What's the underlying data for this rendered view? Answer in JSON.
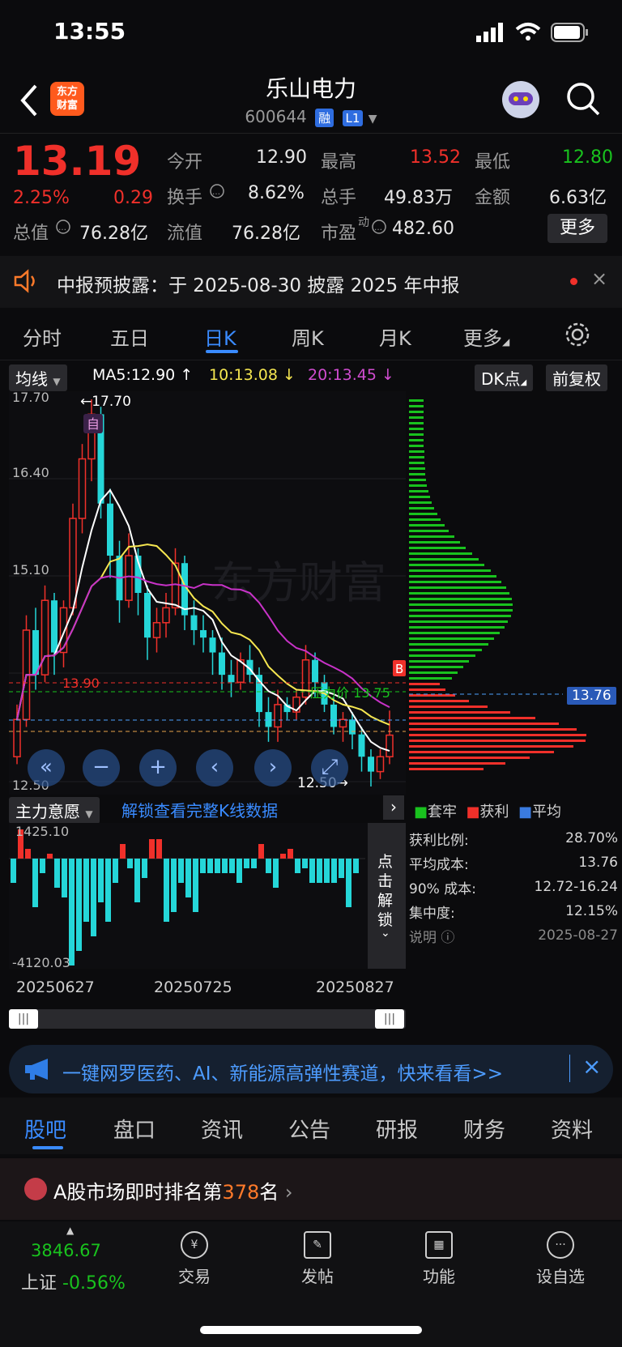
{
  "status": {
    "time": "13:55"
  },
  "header": {
    "title": "乐山电力",
    "code": "600644",
    "tag1": "融",
    "tag2": "L1",
    "logo_line1": "东方",
    "logo_line2": "财富"
  },
  "quote": {
    "price": "13.19",
    "pct": "2.25%",
    "chg": "0.29",
    "open_label": "今开",
    "open": "12.90",
    "high_label": "最高",
    "high": "13.52",
    "low_label": "最低",
    "low": "12.80",
    "turnover_label": "换手",
    "turnover": "8.62%",
    "volume_label": "总手",
    "volume": "49.83万",
    "amount_label": "金额",
    "amount": "6.63亿",
    "mktcap_label": "总值",
    "mktcap": "76.28亿",
    "float_label": "流值",
    "float": "76.28亿",
    "pe_label": "市盈",
    "pe_sup": "动",
    "pe": "482.60",
    "more": "更多"
  },
  "notice": {
    "text": "中报预披露：于 2025-08-30 披露 2025 年中报"
  },
  "chart_tabs": [
    "分时",
    "五日",
    "日K",
    "周K",
    "月K",
    "更多",
    ""
  ],
  "chart_tabs_active": 2,
  "ma_bar": {
    "select": "均线",
    "ma5": "MA5:12.90 ↑",
    "ma10": "10:13.08 ↓",
    "ma20": "20:13.45 ↓",
    "dk": "DK点",
    "adj": "前复权"
  },
  "price_axis": {
    "p1": "17.70",
    "p2": "16.40",
    "p3": "15.10",
    "p5": "12.50"
  },
  "annotations": {
    "high": "←17.70",
    "low": "12.50→",
    "red_line": "13.90",
    "green_line": "压力价 13.75",
    "avg_cost": "13.76",
    "marker_self": "自",
    "marker_b": "B"
  },
  "sub": {
    "select": "主力意愿",
    "unlock": "解锁查看完整K线数据",
    "top": "1425.10",
    "bottom": "-4120.03",
    "side": "点击解锁"
  },
  "dates": [
    "20250627",
    "20250725",
    "20250827"
  ],
  "chip": {
    "legend": [
      "套牢",
      "获利",
      "平均"
    ],
    "rows": [
      {
        "k": "获利比例:",
        "v": "28.70%"
      },
      {
        "k": "平均成本:",
        "v": "13.76"
      },
      {
        "k": "90% 成本:",
        "v": "12.72-16.24"
      },
      {
        "k": "集中度:",
        "v": "12.15%"
      }
    ],
    "note": "说明",
    "date": "2025-08-27"
  },
  "ad": {
    "text": "一键网罗医药、AI、新能源高弹性赛道，快来看看>>"
  },
  "bottom_tabs": [
    "股吧",
    "盘口",
    "资讯",
    "公告",
    "研报",
    "财务",
    "资料"
  ],
  "rank": {
    "prefix": "A股市场即时排名第",
    "num": "378",
    "suffix": "名"
  },
  "index": {
    "value": "3846.67",
    "name": "上证",
    "pct": "-0.56%"
  },
  "nav": [
    "交易",
    "发帖",
    "功能",
    "设自选"
  ],
  "colors": {
    "up": "#f0302a",
    "down": "#19c21e",
    "cyan": "#25d6d8",
    "ma5": "#ffffff",
    "ma10": "#f5e650",
    "ma20": "#c832c8"
  },
  "chart_data": {
    "type": "candlestick",
    "ylim": [
      12.5,
      17.7
    ],
    "candles": [
      {
        "o": 12.9,
        "c": 13.4,
        "h": 13.6,
        "l": 12.8
      },
      {
        "o": 13.4,
        "c": 14.6,
        "h": 14.8,
        "l": 13.3
      },
      {
        "o": 14.6,
        "c": 14.0,
        "h": 14.9,
        "l": 13.8
      },
      {
        "o": 14.0,
        "c": 15.0,
        "h": 15.2,
        "l": 13.9
      },
      {
        "o": 15.0,
        "c": 14.3,
        "h": 15.1,
        "l": 14.0
      },
      {
        "o": 14.3,
        "c": 14.9,
        "h": 15.0,
        "l": 14.1
      },
      {
        "o": 14.9,
        "c": 16.1,
        "h": 16.3,
        "l": 14.8
      },
      {
        "o": 16.1,
        "c": 16.9,
        "h": 17.1,
        "l": 15.9
      },
      {
        "o": 16.9,
        "c": 17.5,
        "h": 17.7,
        "l": 16.6
      },
      {
        "o": 17.5,
        "c": 16.3,
        "h": 17.6,
        "l": 16.1
      },
      {
        "o": 16.3,
        "c": 15.6,
        "h": 16.5,
        "l": 15.3
      },
      {
        "o": 15.6,
        "c": 15.0,
        "h": 15.8,
        "l": 14.7
      },
      {
        "o": 15.0,
        "c": 15.6,
        "h": 15.9,
        "l": 14.9
      },
      {
        "o": 15.6,
        "c": 15.1,
        "h": 15.7,
        "l": 14.8
      },
      {
        "o": 15.1,
        "c": 14.5,
        "h": 15.2,
        "l": 14.2
      },
      {
        "o": 14.5,
        "c": 14.7,
        "h": 14.9,
        "l": 14.3
      },
      {
        "o": 14.7,
        "c": 14.9,
        "h": 15.1,
        "l": 14.5
      },
      {
        "o": 14.9,
        "c": 15.5,
        "h": 15.7,
        "l": 14.8
      },
      {
        "o": 15.5,
        "c": 14.8,
        "h": 15.6,
        "l": 14.6
      },
      {
        "o": 14.8,
        "c": 14.6,
        "h": 15.0,
        "l": 14.4
      },
      {
        "o": 14.6,
        "c": 14.5,
        "h": 14.8,
        "l": 14.3
      },
      {
        "o": 14.5,
        "c": 14.3,
        "h": 14.6,
        "l": 14.0
      },
      {
        "o": 14.3,
        "c": 14.0,
        "h": 14.5,
        "l": 13.8
      },
      {
        "o": 14.0,
        "c": 13.9,
        "h": 14.2,
        "l": 13.7
      },
      {
        "o": 13.9,
        "c": 14.2,
        "h": 14.3,
        "l": 13.8
      },
      {
        "o": 14.2,
        "c": 14.0,
        "h": 14.4,
        "l": 13.9
      },
      {
        "o": 14.0,
        "c": 13.5,
        "h": 14.1,
        "l": 13.3
      },
      {
        "o": 13.5,
        "c": 13.3,
        "h": 13.7,
        "l": 13.1
      },
      {
        "o": 13.3,
        "c": 13.6,
        "h": 13.8,
        "l": 13.1
      },
      {
        "o": 13.6,
        "c": 13.5,
        "h": 13.7,
        "l": 13.4
      },
      {
        "o": 13.5,
        "c": 13.7,
        "h": 13.8,
        "l": 13.4
      },
      {
        "o": 13.7,
        "c": 14.2,
        "h": 14.4,
        "l": 13.6
      },
      {
        "o": 14.2,
        "c": 13.9,
        "h": 14.3,
        "l": 13.7
      },
      {
        "o": 13.9,
        "c": 13.6,
        "h": 14.0,
        "l": 13.5
      },
      {
        "o": 13.6,
        "c": 13.3,
        "h": 13.7,
        "l": 13.2
      },
      {
        "o": 13.3,
        "c": 13.4,
        "h": 13.5,
        "l": 13.1
      },
      {
        "o": 13.4,
        "c": 13.2,
        "h": 13.5,
        "l": 13.0
      },
      {
        "o": 13.2,
        "c": 12.9,
        "h": 13.3,
        "l": 12.7
      },
      {
        "o": 12.9,
        "c": 12.7,
        "h": 13.0,
        "l": 12.5
      },
      {
        "o": 12.7,
        "c": 12.9,
        "h": 13.0,
        "l": 12.6
      },
      {
        "o": 12.9,
        "c": 13.19,
        "h": 13.52,
        "l": 12.8
      }
    ]
  }
}
